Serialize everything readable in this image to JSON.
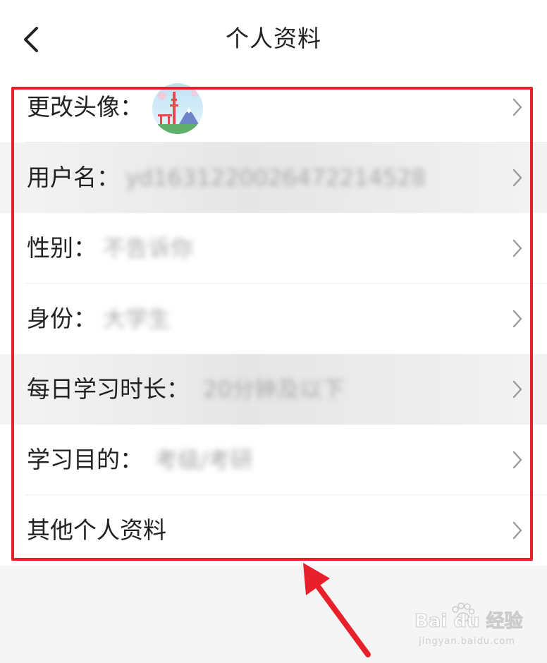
{
  "header": {
    "title": "个人资料",
    "back_icon": "chevron-left-icon"
  },
  "rows": [
    {
      "label": "更改头像：",
      "value": "",
      "has_avatar": true
    },
    {
      "label": "用户名：",
      "value": "yd1631220026472214528"
    },
    {
      "label": "性别：",
      "value": "不告诉你"
    },
    {
      "label": "身份：",
      "value": "大学生"
    },
    {
      "label": "每日学习时长：",
      "value": "20分钟及以下"
    },
    {
      "label": "学习目的：",
      "value": "考级/考研"
    },
    {
      "label": "其他个人资料",
      "value": ""
    }
  ],
  "annotation": {
    "highlight_color": "#e8202c"
  },
  "watermark": {
    "logo": "Bai du 经验",
    "url": "jingyan.baidu.com"
  },
  "colors": {
    "text": "#222222",
    "value_blurred": "#a8a8a8",
    "chevron": "#9a9a9a",
    "background": "#f6f6f6"
  }
}
